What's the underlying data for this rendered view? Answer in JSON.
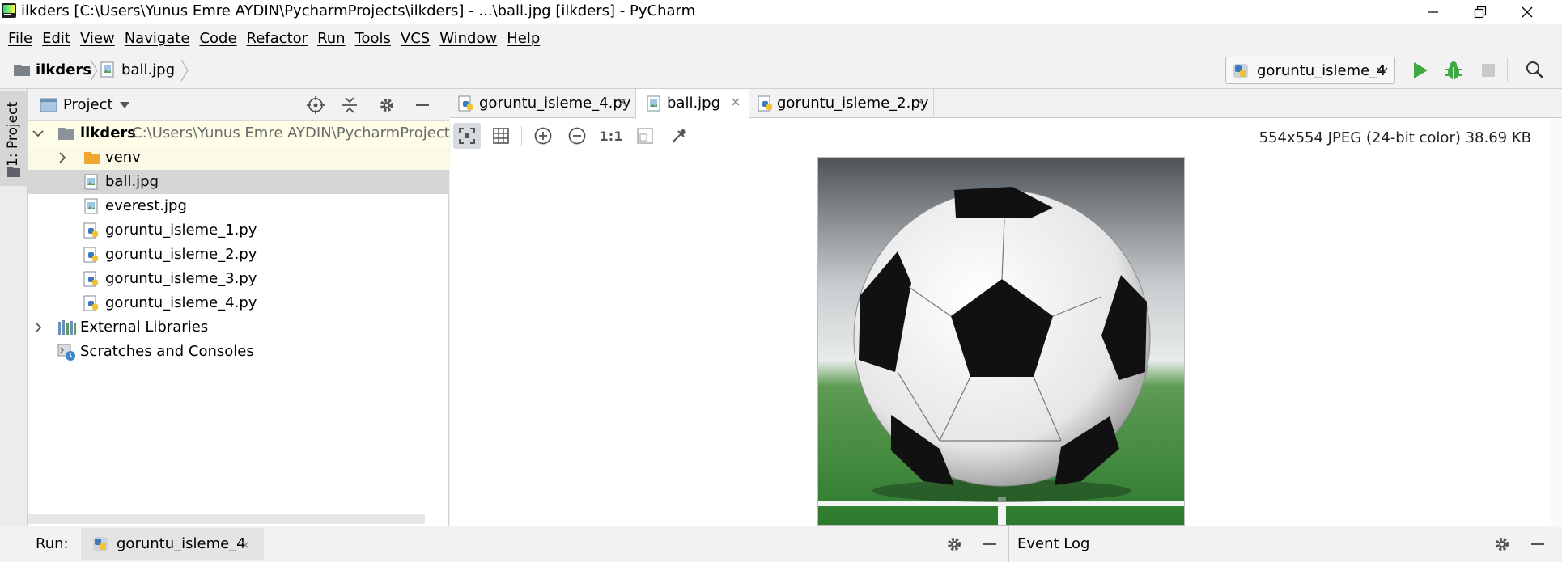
{
  "window": {
    "title": "ilkders [C:\\Users\\Yunus Emre AYDIN\\PycharmProjects\\ilkders] - ...\\ball.jpg [ilkders] - PyCharm"
  },
  "menu": [
    "File",
    "Edit",
    "View",
    "Navigate",
    "Code",
    "Refactor",
    "Run",
    "Tools",
    "VCS",
    "Window",
    "Help"
  ],
  "breadcrumb": {
    "project": "ilkders",
    "file": "ball.jpg"
  },
  "run_config": {
    "name": "goruntu_isleme_4"
  },
  "left_stripe": {
    "label": "1: Project"
  },
  "project_panel": {
    "title": "Project",
    "root": {
      "name": "ilkders",
      "path": "C:\\Users\\Yunus Emre AYDIN\\PycharmProjects\\ilkc"
    },
    "items": [
      {
        "name": "venv",
        "type": "folder"
      },
      {
        "name": "ball.jpg",
        "type": "image",
        "selected": true
      },
      {
        "name": "everest.jpg",
        "type": "image"
      },
      {
        "name": "goruntu_isleme_1.py",
        "type": "python"
      },
      {
        "name": "goruntu_isleme_2.py",
        "type": "python"
      },
      {
        "name": "goruntu_isleme_3.py",
        "type": "python"
      },
      {
        "name": "goruntu_isleme_4.py",
        "type": "python"
      }
    ],
    "external_libraries": "External Libraries",
    "scratches": "Scratches and Consoles"
  },
  "editor": {
    "tabs": [
      {
        "label": "goruntu_isleme_4.py",
        "type": "python"
      },
      {
        "label": "ball.jpg",
        "type": "image",
        "active": true
      },
      {
        "label": "goruntu_isleme_2.py",
        "type": "python"
      }
    ],
    "image_info": "554x554 JPEG (24-bit color) 38.69 KB",
    "zoom_actual": "1:1"
  },
  "bottom": {
    "run_label": "Run:",
    "run_tab": "goruntu_isleme_4",
    "event_log": "Event Log"
  },
  "colors": {
    "selection": "#d5d5d5",
    "root_highlight": "#fdfde8",
    "venv_highlight": "#fbfae6",
    "run_green": "#3ea943",
    "folder_orange": "#f0a732"
  }
}
